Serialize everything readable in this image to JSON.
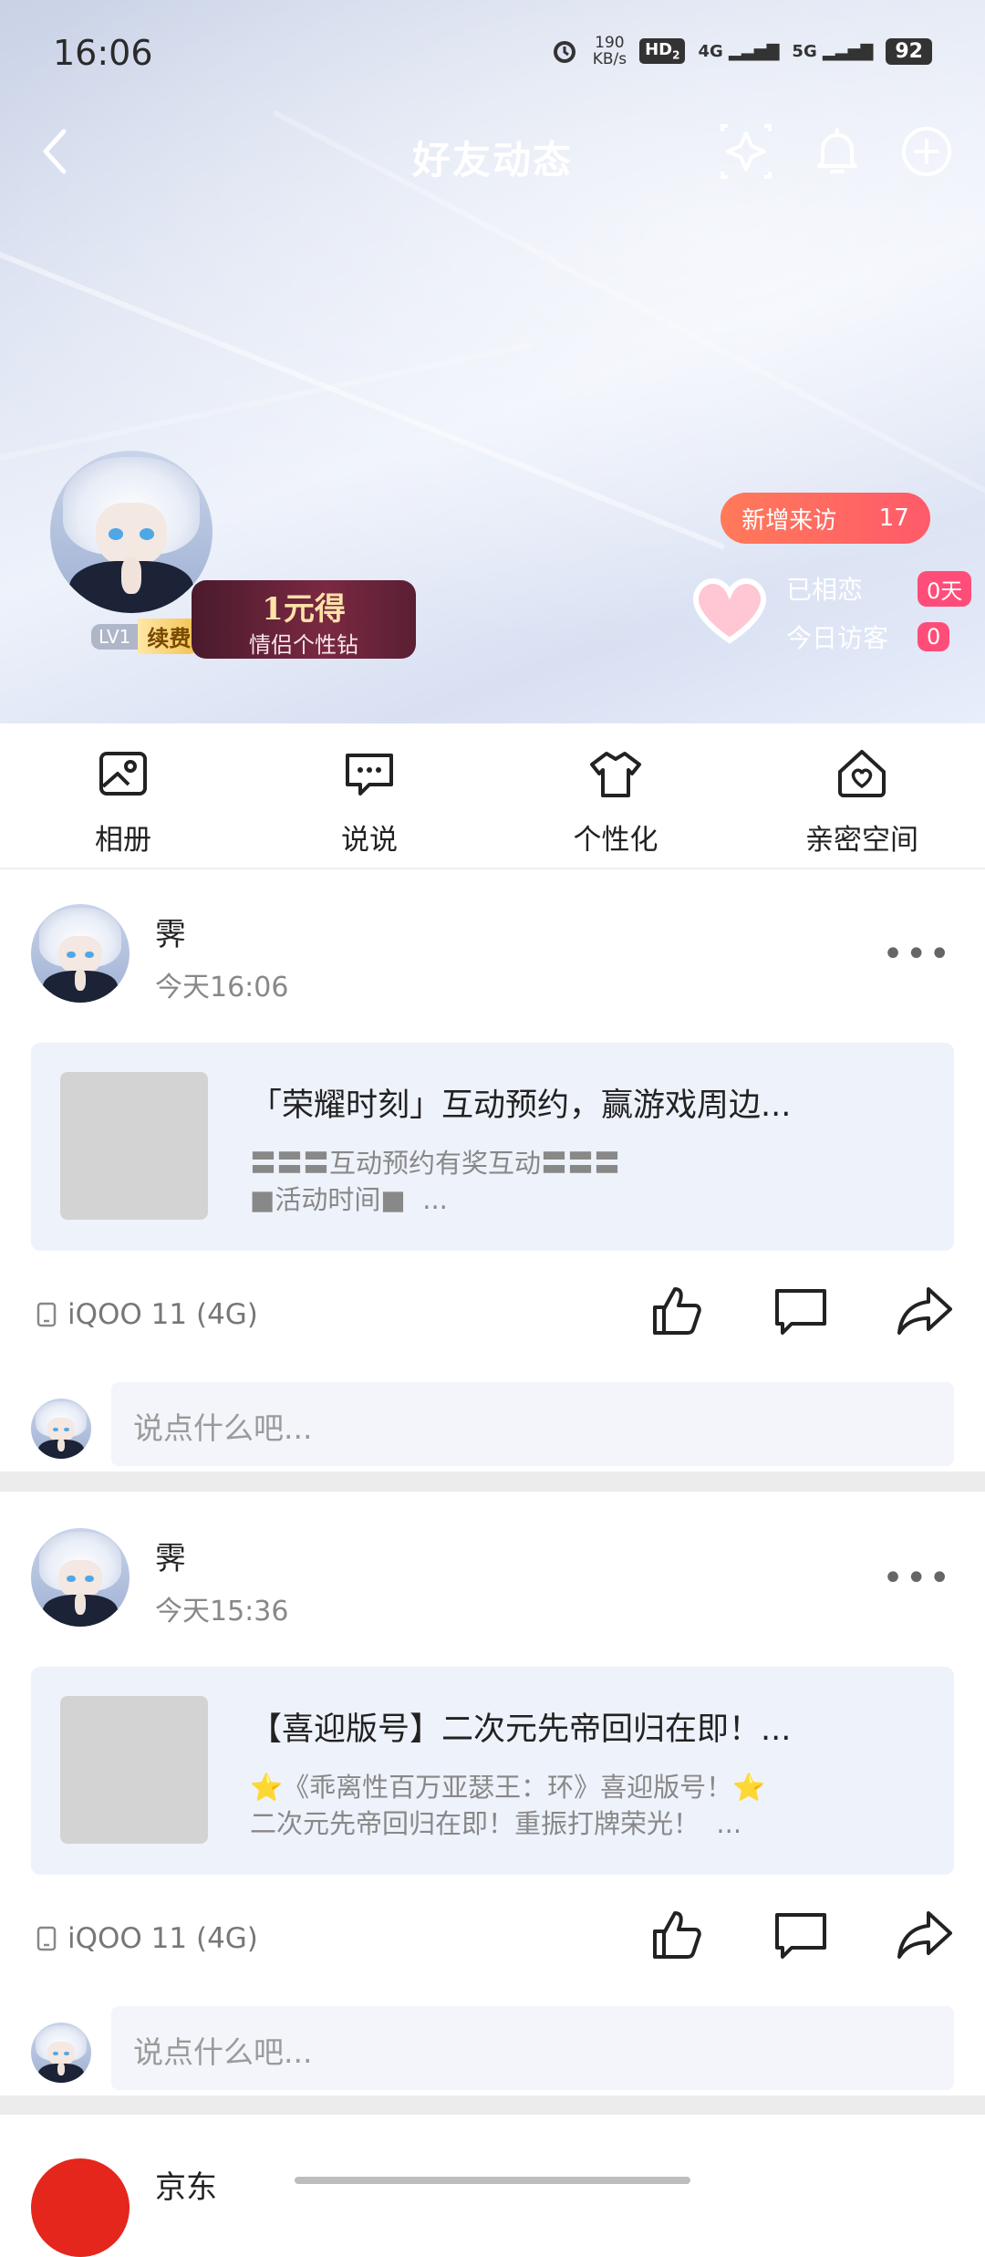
{
  "status_bar": {
    "time": "16:06",
    "net_speed_value": "190",
    "net_speed_unit": "KB/s",
    "hd": "HD",
    "hd_sub": "2",
    "net1": "4G",
    "net2": "5G",
    "battery": "92"
  },
  "nav": {
    "title": "好友动态"
  },
  "profile": {
    "level": "LV1",
    "renew": "续费",
    "promo_line1": "1元得",
    "promo_line2": "情侣个性钻",
    "new_visitors_label": "新增来访",
    "new_visitors_count": "17",
    "together_label": "已相恋",
    "together_value": "0天",
    "today_visitors_label": "今日访客",
    "today_visitors_value": "0"
  },
  "tabs": [
    {
      "label": "相册",
      "icon": "album-icon"
    },
    {
      "label": "说说",
      "icon": "talk-icon"
    },
    {
      "label": "个性化",
      "icon": "tshirt-icon"
    },
    {
      "label": "亲密空间",
      "icon": "intimate-home-icon"
    }
  ],
  "posts": [
    {
      "name": "霁",
      "time": "今天16:06",
      "title": "「荣耀时刻」互动预约，赢游戏周边...",
      "desc": "〓〓〓互动预约有奖互动〓〓〓\n■活动时间■  ...",
      "device": "iQOO 11 (4G)",
      "comment_placeholder": "说点什么吧..."
    },
    {
      "name": "霁",
      "time": "今天15:36",
      "title": "【喜迎版号】二次元先帝回归在即！...",
      "desc": "⭐《乖离性百万亚瑟王：环》喜迎版号！⭐\n二次元先帝回归在即！重振打牌荣光！  ...",
      "device": "iQOO 11 (4G)",
      "comment_placeholder": "说点什么吧..."
    }
  ],
  "next_post": {
    "name": "京东"
  },
  "colors": {
    "visitor_pill": "#ff5a6a",
    "card_bg": "#eef2fb",
    "badge_pink": "#ff4d7a"
  }
}
